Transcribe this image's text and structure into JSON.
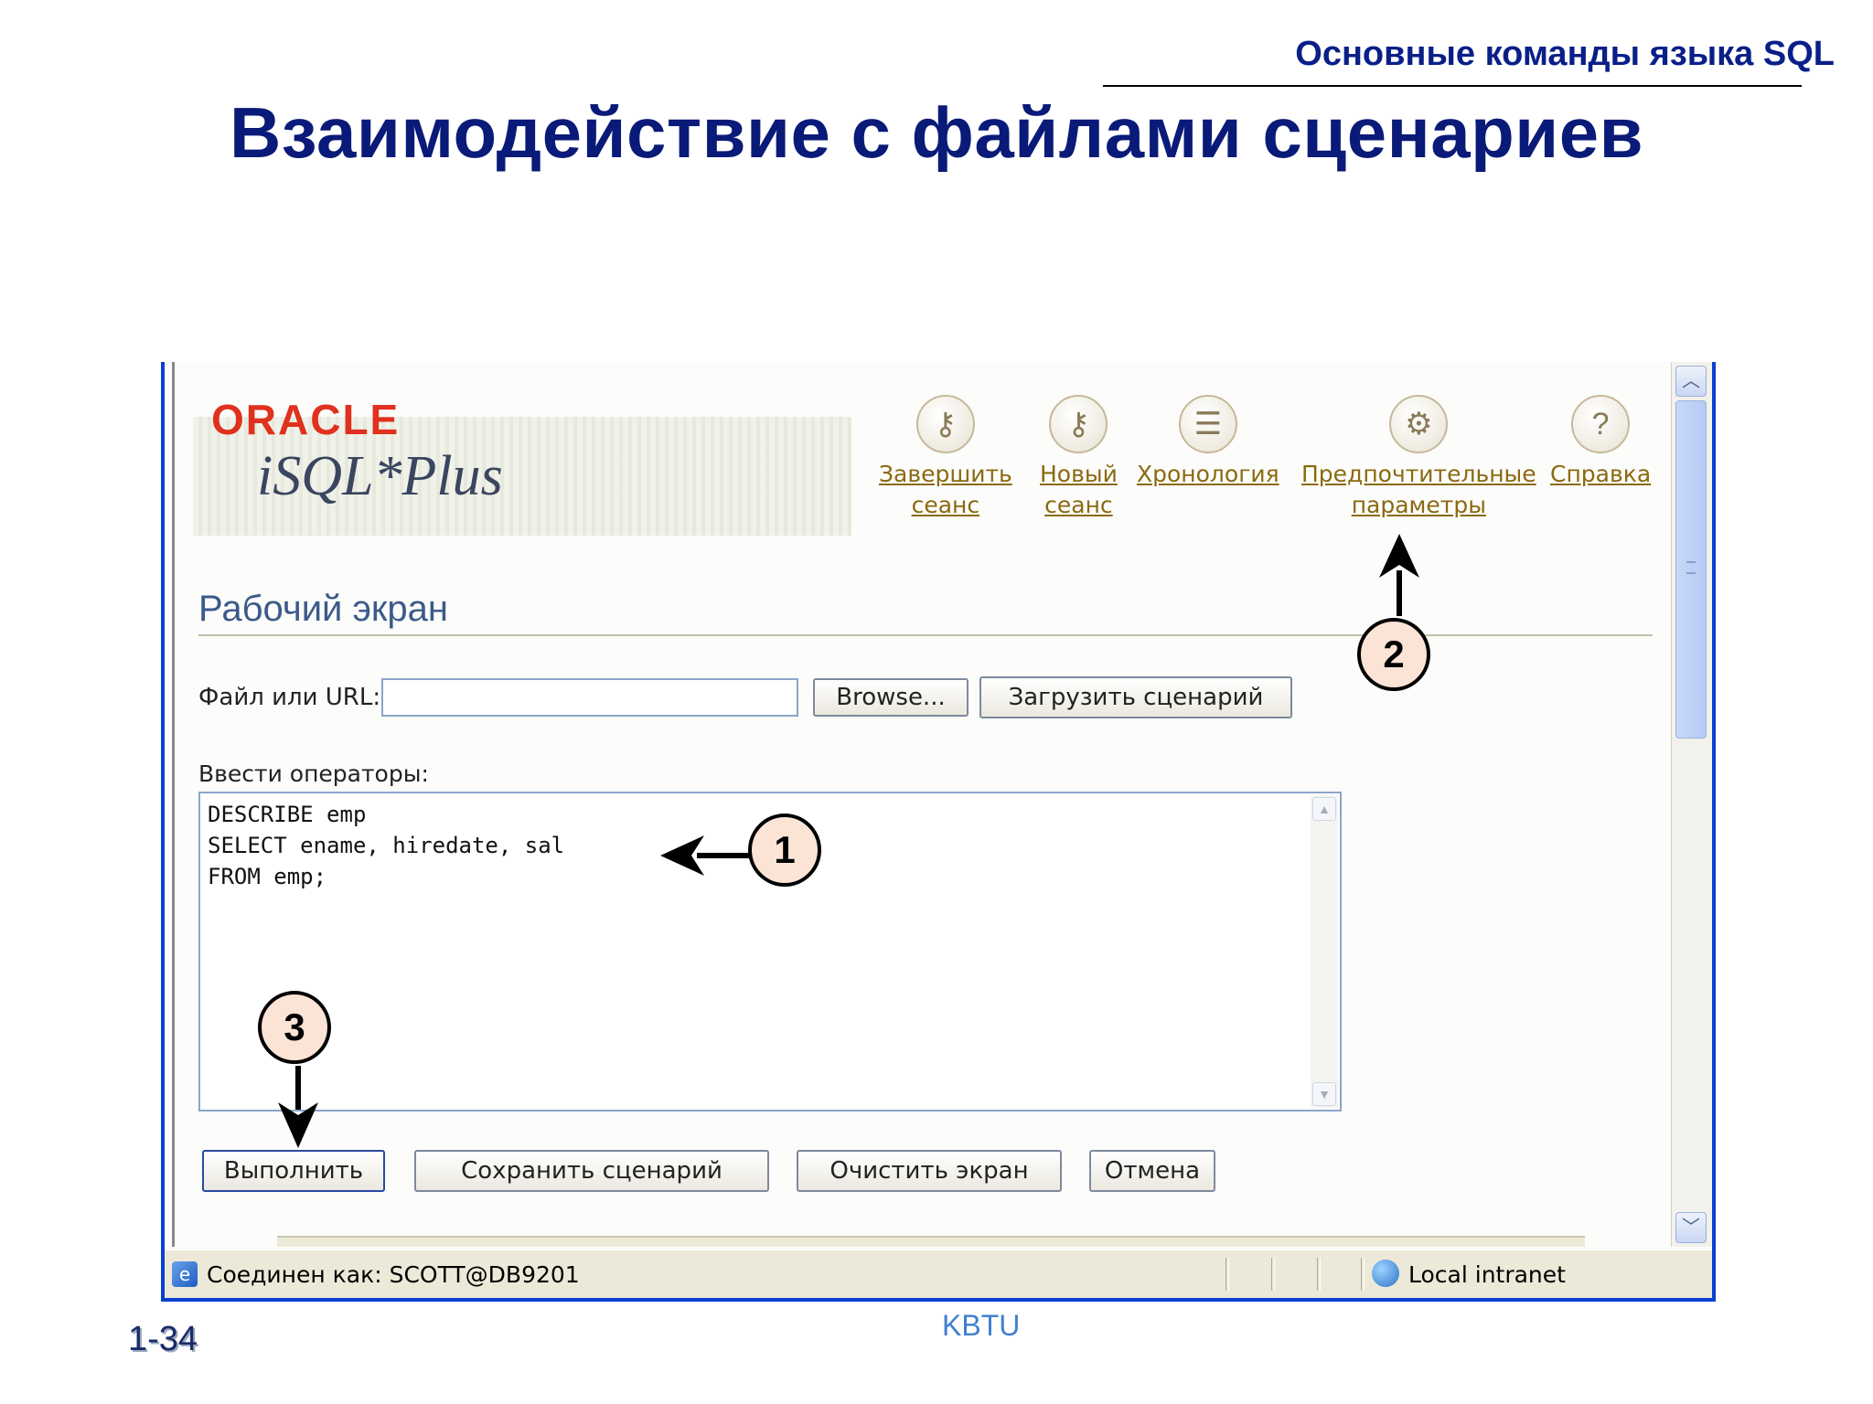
{
  "slide": {
    "section": "Основные команды языка SQL",
    "title": "Взаимодействие с файлами сценариев",
    "number": "1-34",
    "footer": "KBTU"
  },
  "app": {
    "logo_oracle": "ORACLE",
    "logo_product": "iSQL*Plus"
  },
  "nav": {
    "logout": {
      "line1": "Завершить",
      "line2": "сеанс"
    },
    "new_session": {
      "line1": "Новый",
      "line2": "сеанс"
    },
    "history": {
      "line1": "Хронология"
    },
    "preferences": {
      "line1": "Предпочтительные",
      "line2": "параметры"
    },
    "help": {
      "line1": "Справка"
    }
  },
  "workspace": {
    "title": "Рабочий экран",
    "file_label": "Файл или URL:",
    "file_value": "",
    "browse_label": "Browse...",
    "load_label": "Загрузить сценарий",
    "statements_label": "Ввести операторы:",
    "statements": "DESCRIBE emp\nSELECT ename, hiredate, sal\nFROM emp;",
    "run_label": "Выполнить",
    "save_label": "Сохранить сценарий",
    "clear_label": "Очистить экран",
    "cancel_label": "Отмена"
  },
  "status": {
    "connection": "Соединен как: SCOTT@DB9201",
    "zone": "Local intranet"
  },
  "callouts": [
    "1",
    "2",
    "3"
  ],
  "colors": {
    "title": "#0a1a78",
    "oracle_red": "#e0301e",
    "link": "#8a6a10",
    "callout_fill": "#fbe3d6"
  }
}
